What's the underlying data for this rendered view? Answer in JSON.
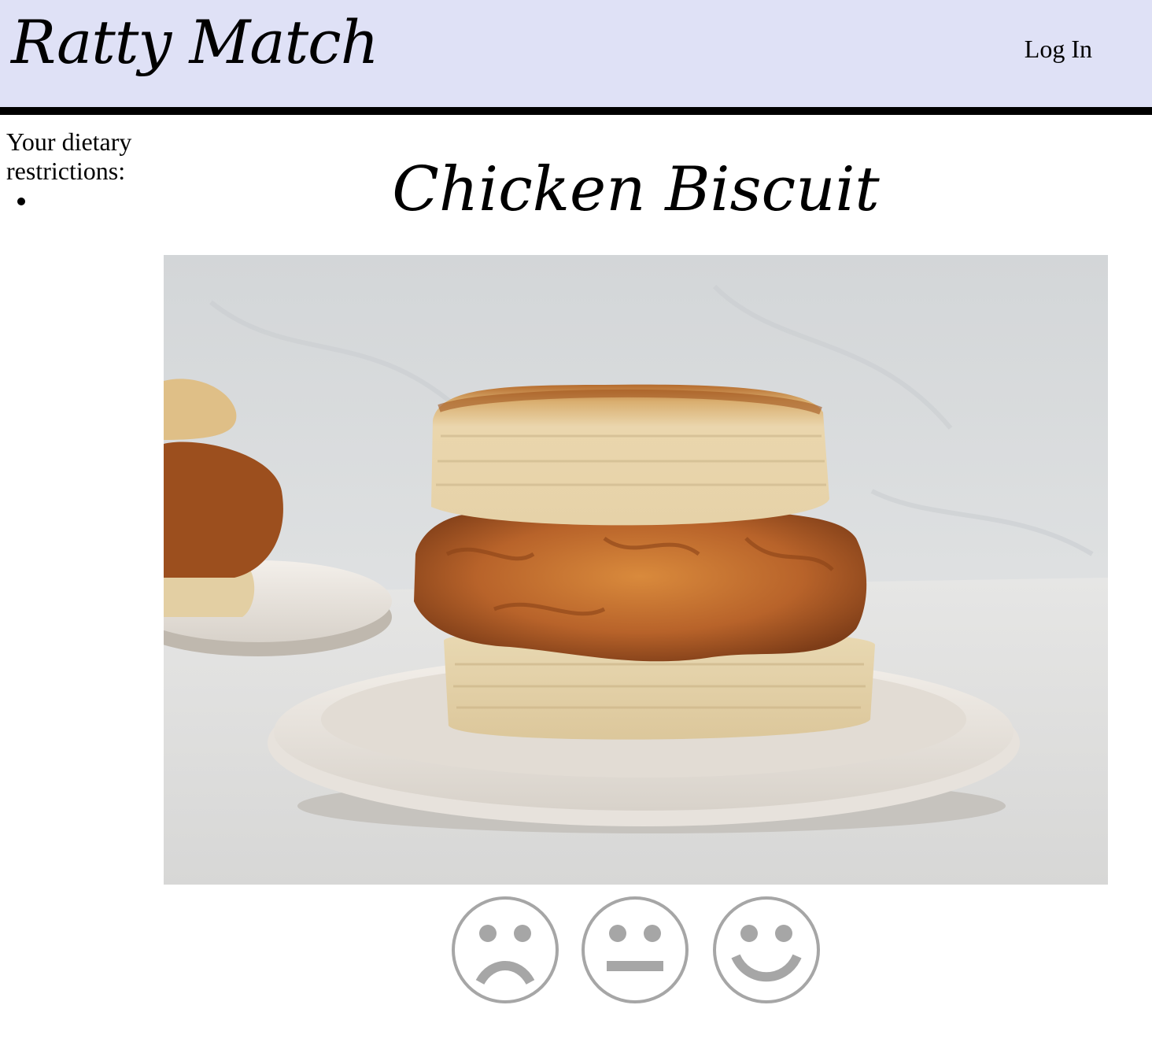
{
  "header": {
    "brand": "Ratty Match",
    "login_label": "Log In",
    "background": "#dfe1f6"
  },
  "sidebar": {
    "label": "Your dietary restrictions:",
    "restrictions": [
      ""
    ]
  },
  "dish": {
    "name": "Chicken Biscuit",
    "image_icon": "chicken-biscuit-photo"
  },
  "ratings": [
    {
      "name": "dislike",
      "icon": "frown-face-icon"
    },
    {
      "name": "neutral",
      "icon": "neutral-face-icon"
    },
    {
      "name": "like",
      "icon": "smile-face-icon"
    }
  ],
  "colors": {
    "rating_icon": "#a6a6a6",
    "header_border": "#000000"
  }
}
